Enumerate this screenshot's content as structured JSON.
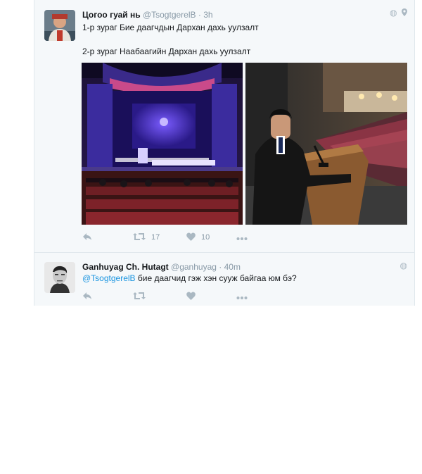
{
  "tweets": [
    {
      "name": "Цогоо гуай нь",
      "handle": "@TsogtgerelB",
      "separator": "·",
      "time": "3h",
      "line1": "1-р зураг Бие даагчдын Дархан дахь уулзалт",
      "line2": "2-р зураг Наабаагийн Дархан дахь уулзалт",
      "retweets": "17",
      "likes": "10"
    },
    {
      "name": "Ganhuyag Ch. Hutagt",
      "handle": "@ganhuyag",
      "separator": "·",
      "time": "40m",
      "mention": "@TsogtgerelB",
      "body": " бие даагчид гэж хэн сууж байгаа юм бэ?"
    }
  ],
  "icons": {
    "reply": "reply-arrow-icon",
    "retweet": "retweet-icon",
    "like": "heart-icon",
    "more": "more-dots-icon",
    "privacy": "globe-icon",
    "location": "location-pin-icon"
  },
  "colors": {
    "link": "#1b95e0",
    "muted": "#8899a6",
    "icon": "#aab8c2",
    "background": "#f5f8fa"
  }
}
